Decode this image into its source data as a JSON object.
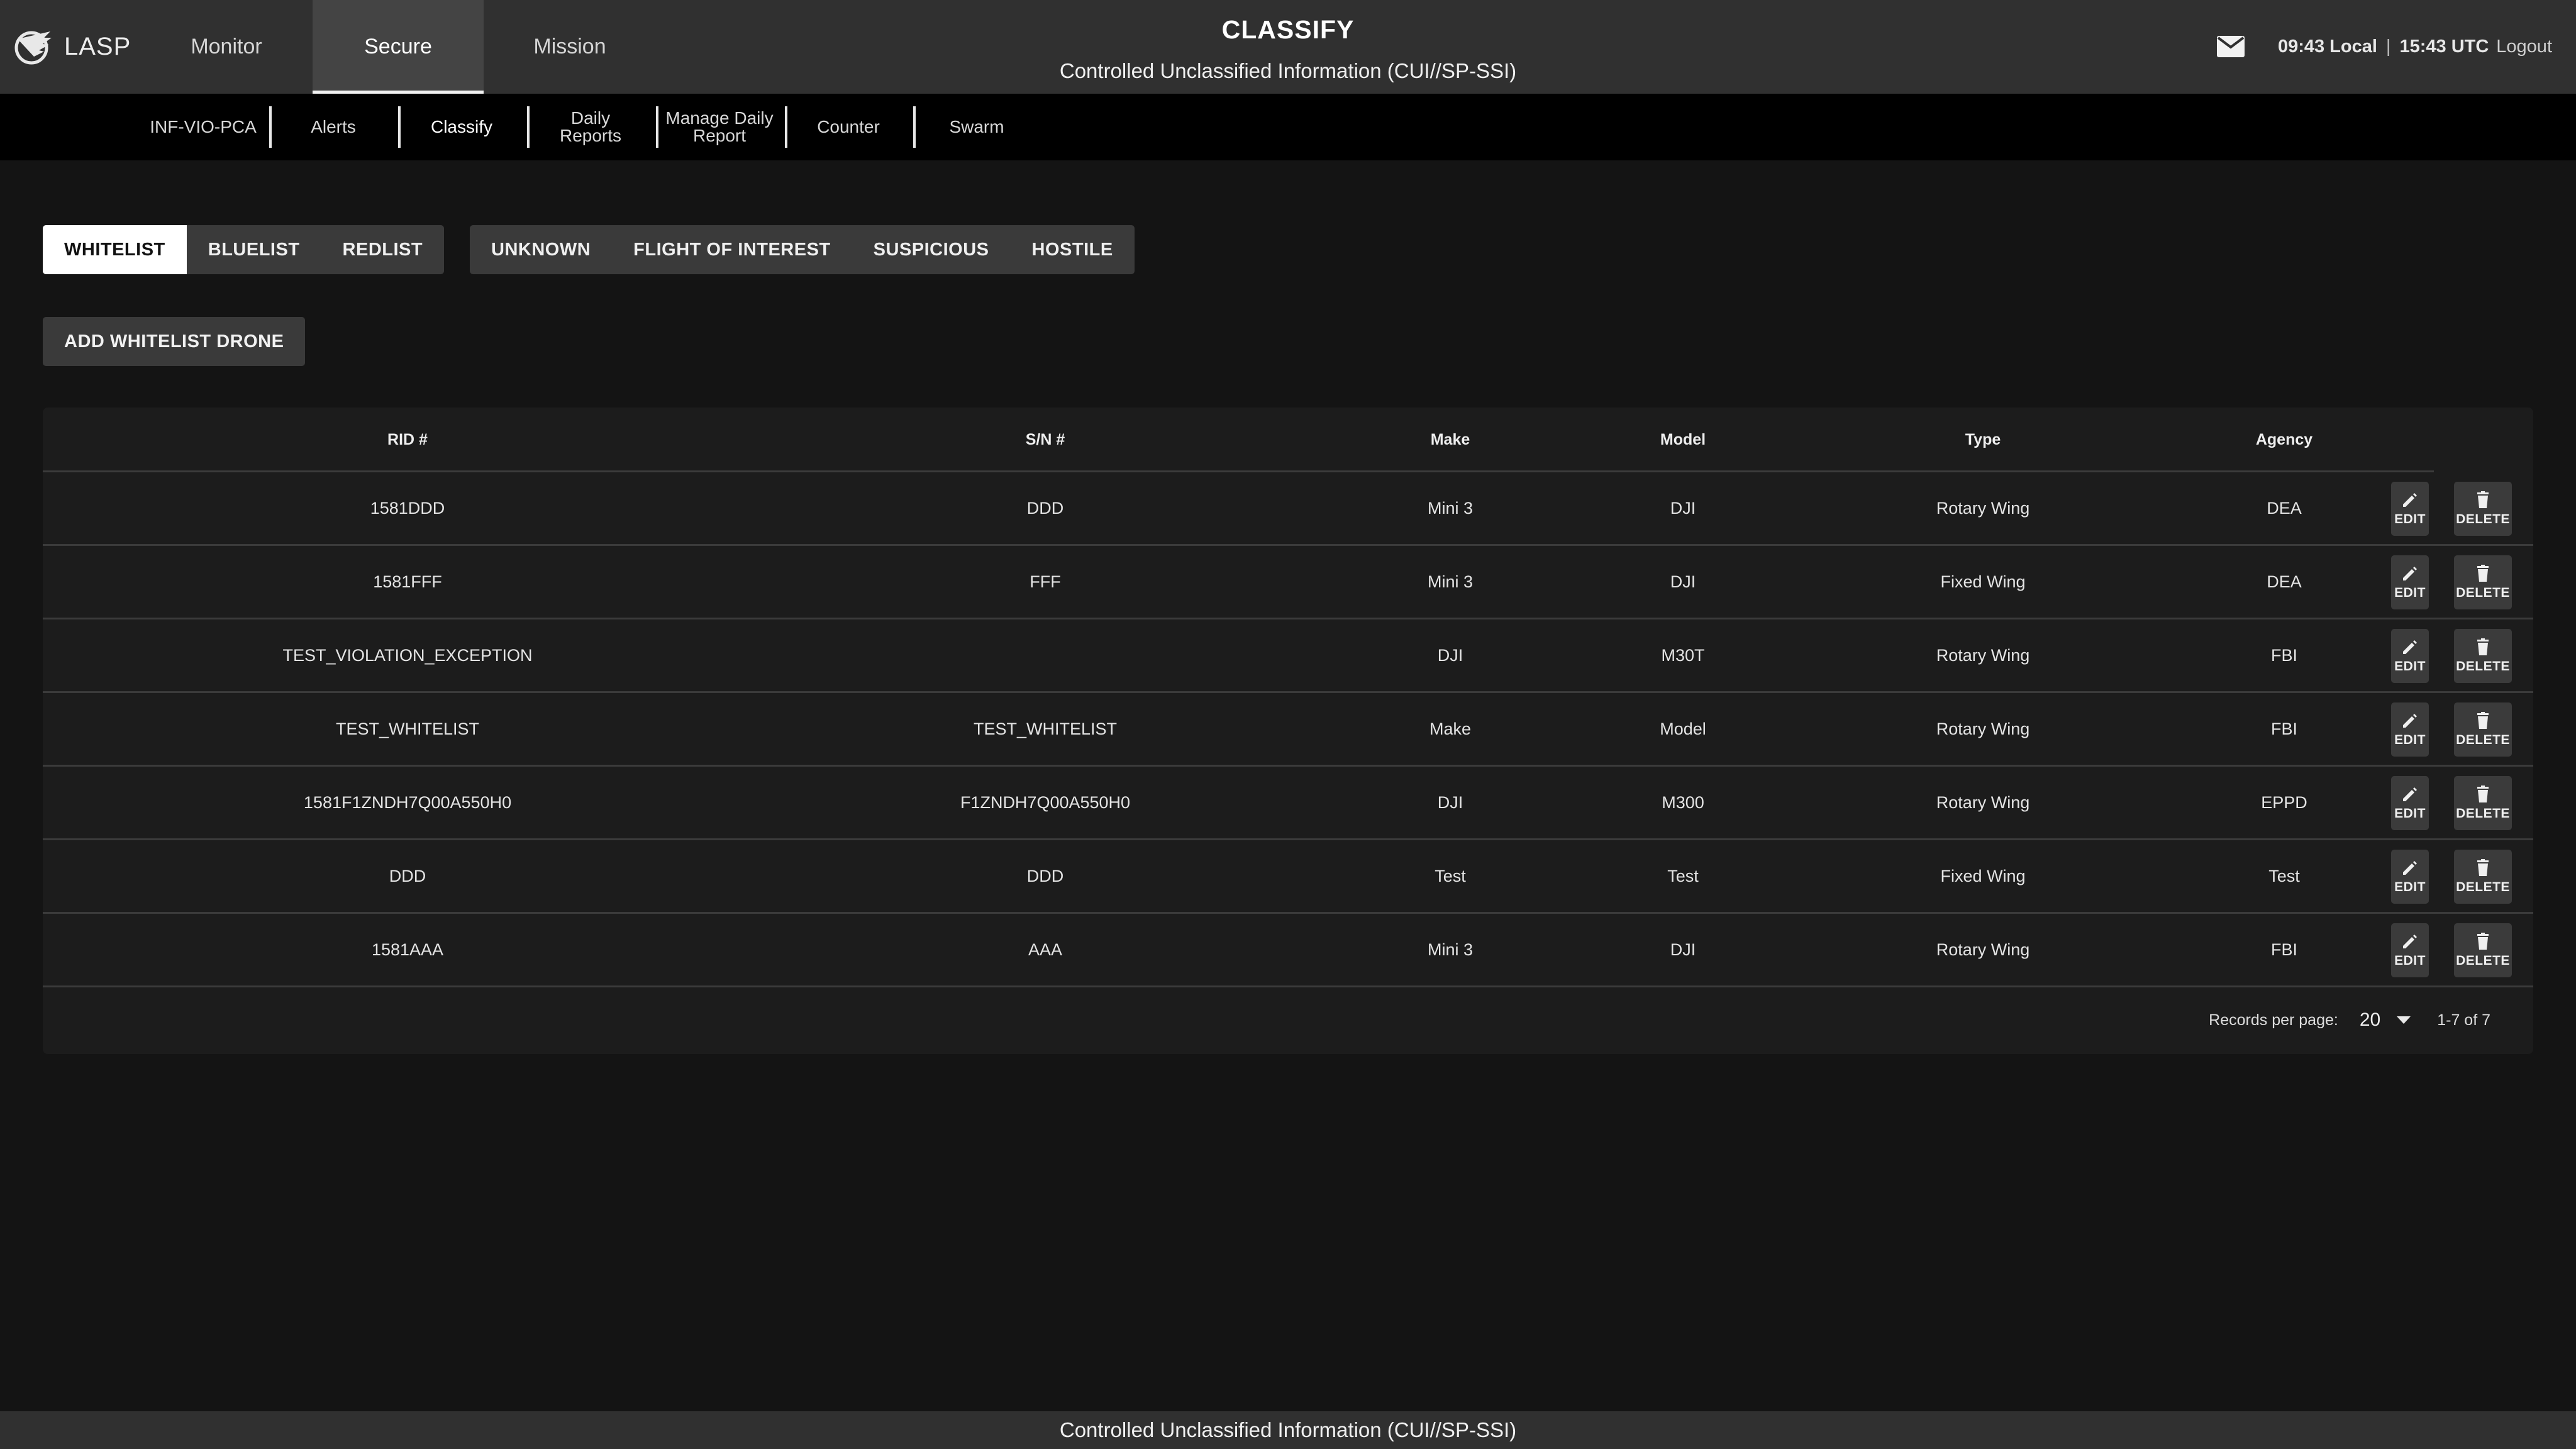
{
  "app": {
    "name": "LASP"
  },
  "nav": {
    "tabs": [
      {
        "label": "Monitor"
      },
      {
        "label": "Secure"
      },
      {
        "label": "Mission"
      }
    ],
    "active": "Secure"
  },
  "header": {
    "title": "CLASSIFY",
    "subtitle": "Controlled Unclassified Information (CUI//SP-SSI)",
    "local_time": "09:43 Local",
    "separator": "|",
    "utc_time": "15:43 UTC",
    "logout": "Logout"
  },
  "subnav": {
    "tabs": [
      {
        "label": "INF-VIO-PCA"
      },
      {
        "label": "Alerts"
      },
      {
        "label": "Classify"
      },
      {
        "label": "Daily Reports"
      },
      {
        "label": "Manage Daily Report"
      },
      {
        "label": "Counter"
      },
      {
        "label": "Swarm"
      }
    ],
    "active": "Classify"
  },
  "list_filters": [
    "WHITELIST",
    "BLUELIST",
    "REDLIST"
  ],
  "list_filter_active": "WHITELIST",
  "threat_filters": [
    "UNKNOWN",
    "FLIGHT OF INTEREST",
    "SUSPICIOUS",
    "HOSTILE"
  ],
  "add_button": "ADD WHITELIST DRONE",
  "table": {
    "columns": [
      "RID #",
      "S/N #",
      "Make",
      "Model",
      "Type",
      "Agency"
    ],
    "edit_label": "EDIT",
    "delete_label": "DELETE",
    "rows": [
      [
        "1581DDD",
        "DDD",
        "Mini 3",
        "DJI",
        "Rotary Wing",
        "DEA"
      ],
      [
        "1581FFF",
        "FFF",
        "Mini 3",
        "DJI",
        "Fixed Wing",
        "DEA"
      ],
      [
        "TEST_VIOLATION_EXCEPTION",
        "",
        "DJI",
        "M30T",
        "Rotary Wing",
        "FBI"
      ],
      [
        "TEST_WHITELIST",
        "TEST_WHITELIST",
        "Make",
        "Model",
        "Rotary Wing",
        "FBI"
      ],
      [
        "1581F1ZNDH7Q00A550H0",
        "F1ZNDH7Q00A550H0",
        "DJI",
        "M300",
        "Rotary Wing",
        "EPPD"
      ],
      [
        "DDD",
        "DDD",
        "Test",
        "Test",
        "Fixed Wing",
        "Test"
      ],
      [
        "1581AAA",
        "AAA",
        "Mini 3",
        "DJI",
        "Rotary Wing",
        "FBI"
      ]
    ]
  },
  "pagination": {
    "label": "Records per page:",
    "per_page": "20",
    "range": "1-7 of 7"
  },
  "footer": {
    "text": "Controlled Unclassified Information (CUI//SP-SSI)"
  },
  "icons": {
    "logo": "eagle-logo-icon",
    "mail": "mail-icon",
    "edit": "pencil-icon",
    "delete": "trash-icon",
    "dropdown": "caret-down-icon"
  }
}
